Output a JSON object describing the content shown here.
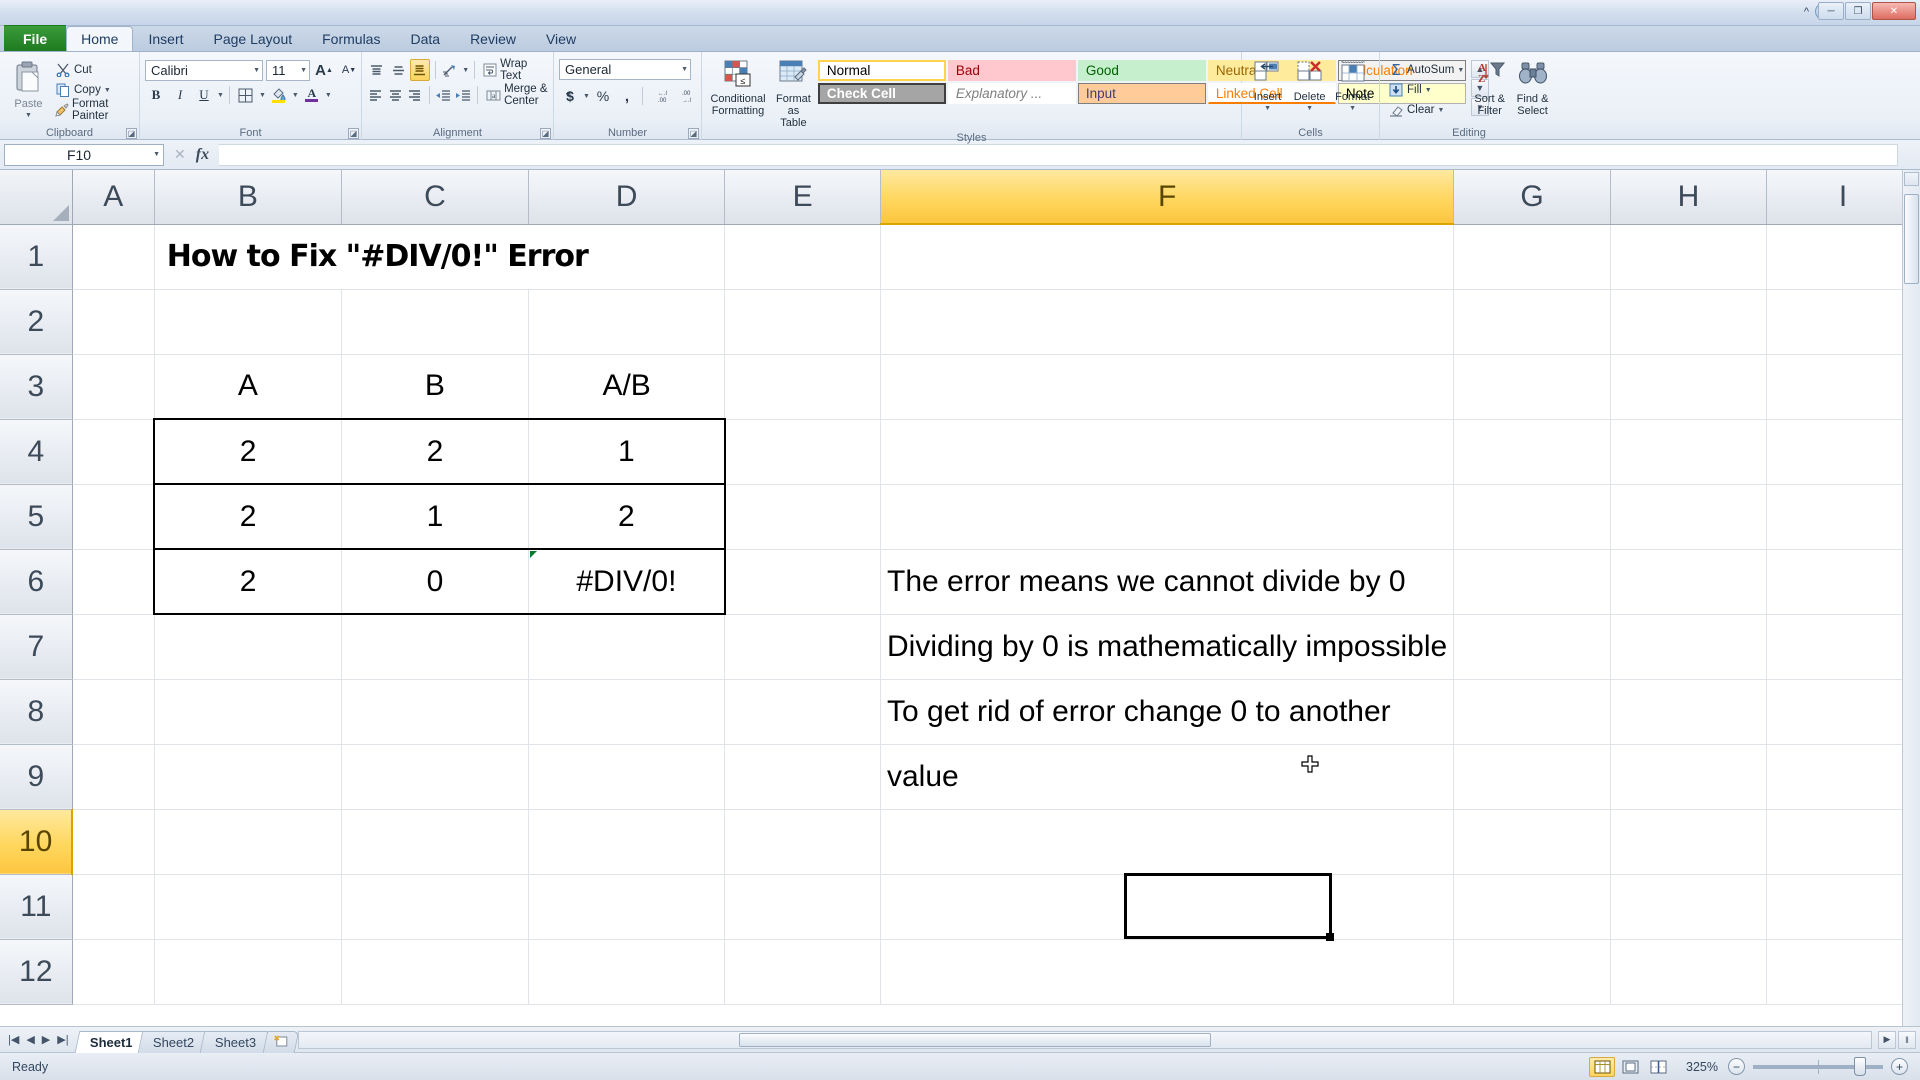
{
  "window": {
    "minimize": "─",
    "restore": "❐",
    "close": "✕",
    "help": "?",
    "ribbon_toggle": "^"
  },
  "tabs": [
    {
      "label": "File",
      "active": false,
      "file": true
    },
    {
      "label": "Home",
      "active": true
    },
    {
      "label": "Insert",
      "active": false
    },
    {
      "label": "Page Layout",
      "active": false
    },
    {
      "label": "Formulas",
      "active": false
    },
    {
      "label": "Data",
      "active": false
    },
    {
      "label": "Review",
      "active": false
    },
    {
      "label": "View",
      "active": false
    }
  ],
  "ribbon": {
    "clipboard": {
      "label": "Clipboard",
      "paste": "Paste",
      "cut": "Cut",
      "copy": "Copy",
      "format_painter": "Format Painter"
    },
    "font": {
      "label": "Font",
      "font_name": "Calibri",
      "font_size": "11",
      "bold": "B",
      "italic": "I",
      "underline": "U",
      "grow_font": "A",
      "shrink_font": "A",
      "borders": "borders",
      "fill_color": "fill-color",
      "font_color": "A"
    },
    "alignment": {
      "label": "Alignment",
      "wrap_text": "Wrap Text",
      "merge_center": "Merge & Center",
      "orientation": "orientation"
    },
    "number": {
      "label": "Number",
      "format": "General",
      "currency": "$",
      "percent": "%",
      "comma": ",",
      "increase_decimal": ".00",
      "decrease_decimal": ".00"
    },
    "styles": {
      "label": "Styles",
      "conditional_formatting": "Conditional\nFormatting",
      "conditional_formatting_l1": "Conditional",
      "conditional_formatting_l2": "Formatting",
      "format_as_table_l1": "Format",
      "format_as_table_l2": "as Table",
      "gallery": [
        {
          "label": "Normal",
          "bg": "#ffffff",
          "fg": "#000000",
          "border": "#ffd34e",
          "selected": true
        },
        {
          "label": "Bad",
          "bg": "#ffc7ce",
          "fg": "#9c0006"
        },
        {
          "label": "Good",
          "bg": "#c6efce",
          "fg": "#006100"
        },
        {
          "label": "Neutral",
          "bg": "#ffeb9c",
          "fg": "#9c6500"
        },
        {
          "label": "Calculation",
          "bg": "#f2f2f2",
          "fg": "#fa7d00",
          "border": "#7f7f7f"
        },
        {
          "label": "Check Cell",
          "bg": "#a5a5a5",
          "fg": "#ffffff",
          "border": "#3f3f3f",
          "bold": true
        },
        {
          "label": "Explanatory ...",
          "bg": "#ffffff",
          "fg": "#7f7f7f",
          "italic": true
        },
        {
          "label": "Input",
          "bg": "#ffcc99",
          "fg": "#3f3f76",
          "border": "#7f7f7f"
        },
        {
          "label": "Linked Cell",
          "bg": "#ffffff",
          "fg": "#fa7d00"
        },
        {
          "label": "Note",
          "bg": "#ffffcc",
          "fg": "#000000",
          "border": "#b2b2b2"
        }
      ]
    },
    "cells": {
      "label": "Cells",
      "insert": "Insert",
      "delete": "Delete",
      "format": "Format"
    },
    "editing": {
      "label": "Editing",
      "autosum": "AutoSum",
      "fill": "Fill",
      "clear": "Clear",
      "sort_filter_l1": "Sort &",
      "sort_filter_l2": "Filter",
      "find_select_l1": "Find &",
      "find_select_l2": "Select"
    }
  },
  "formula_bar": {
    "name_box": "F10",
    "formula": "",
    "cancel": "✕",
    "enter": "✓",
    "insert_function": "fx"
  },
  "grid": {
    "columns": [
      "A",
      "B",
      "C",
      "D",
      "E",
      "F",
      "G",
      "H",
      "I"
    ],
    "selected_column": "F",
    "rows": [
      "1",
      "2",
      "3",
      "4",
      "5",
      "6",
      "7",
      "8",
      "9",
      "10",
      "11",
      "12"
    ],
    "selected_row": "10",
    "active_cell": "F10",
    "cells": {
      "B1": "How to Fix \"#DIV/0!\" Error",
      "B3": "A",
      "C3": "B",
      "D3": "A/B",
      "B4": "2",
      "C4": "2",
      "D4": "1",
      "B5": "2",
      "C5": "1",
      "D5": "2",
      "B6": "2",
      "C6": "0",
      "D6": "#DIV/0!",
      "F6": "The error means we cannot divide by 0",
      "F7": "Dividing by 0 is mathematically impossible",
      "F8": "To get rid of error change 0 to another",
      "F9": "value"
    },
    "title_color": "#7030a0"
  },
  "sheet_tabs": [
    {
      "label": "Sheet1",
      "active": true
    },
    {
      "label": "Sheet2",
      "active": false
    },
    {
      "label": "Sheet3",
      "active": false
    }
  ],
  "status_bar": {
    "status": "Ready",
    "zoom": "325%",
    "views": [
      "normal-view",
      "page-layout-view",
      "page-break-view"
    ],
    "active_view": "normal-view",
    "zoom_out": "−",
    "zoom_in": "+"
  }
}
